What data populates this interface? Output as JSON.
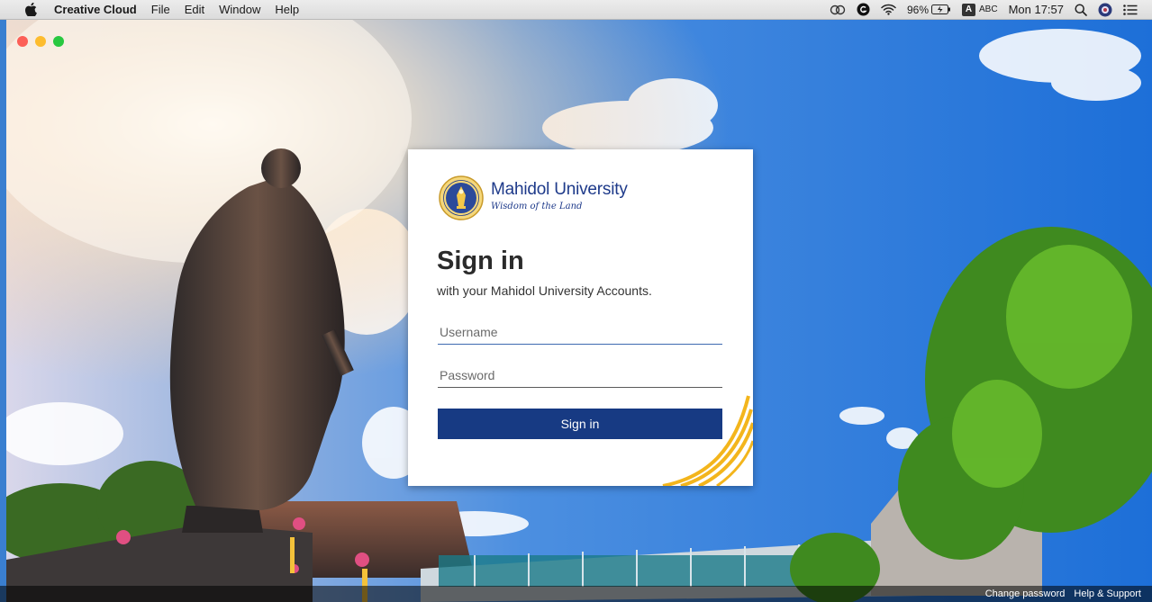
{
  "menubar": {
    "app_name": "Creative Cloud",
    "menus": [
      "File",
      "Edit",
      "Window",
      "Help"
    ],
    "battery": "96%",
    "input_source": "ABC",
    "input_badge": "A",
    "clock": "Mon 17:57"
  },
  "login": {
    "brand_name": "Mahidol University",
    "brand_tagline": "Wisdom of the Land",
    "title": "Sign in",
    "subtitle": "with your Mahidol University Accounts.",
    "username_placeholder": "Username",
    "password_placeholder": "Password",
    "submit_label": "Sign in"
  },
  "footer": {
    "change_password": "Change password",
    "help_support": "Help & Support"
  },
  "colors": {
    "brand_blue": "#173a83",
    "accent_gold": "#f3b51c",
    "close": "#fc5f57",
    "minimize": "#fdbc2e",
    "maximize": "#28c840"
  }
}
